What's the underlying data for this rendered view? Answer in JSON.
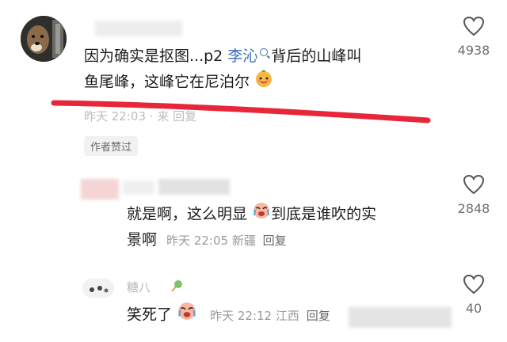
{
  "comments": [
    {
      "username": "",
      "text_before": "因为确实是抠图...p2 ",
      "mention": "李沁",
      "text_after_line1": "背后的山峰叫",
      "text_line2": "鱼尾峰，这峰它在尼泊尔",
      "meta": "昨天 22:03 · 来 回复",
      "badge": "作者赞过",
      "likes": "4938"
    },
    {
      "username": "",
      "text_line1": "就是啊，这么明显",
      "text_line1b": "到底是谁吹的实",
      "text_line2": "景啊",
      "time": "昨天 22:05",
      "location": "新疆",
      "reply": "回复",
      "likes": "2848"
    },
    {
      "username": "糖八",
      "text": "笑死了",
      "time": "昨天 22:12",
      "location": "江西",
      "reply": "回复",
      "likes": "40"
    }
  ],
  "icons": {
    "like": "heart-outline-icon",
    "mention_search": "search-icon",
    "emoji_1": "orange-smile-emoji-icon",
    "emoji_2": "crying-laugh-emoji-icon",
    "emoji_3": "lollipop-icon"
  },
  "colors": {
    "annotation_line": "#e8263a",
    "mention": "#3b6fb6",
    "meta": "#9a9a9a",
    "username": "#b8b8b8"
  }
}
